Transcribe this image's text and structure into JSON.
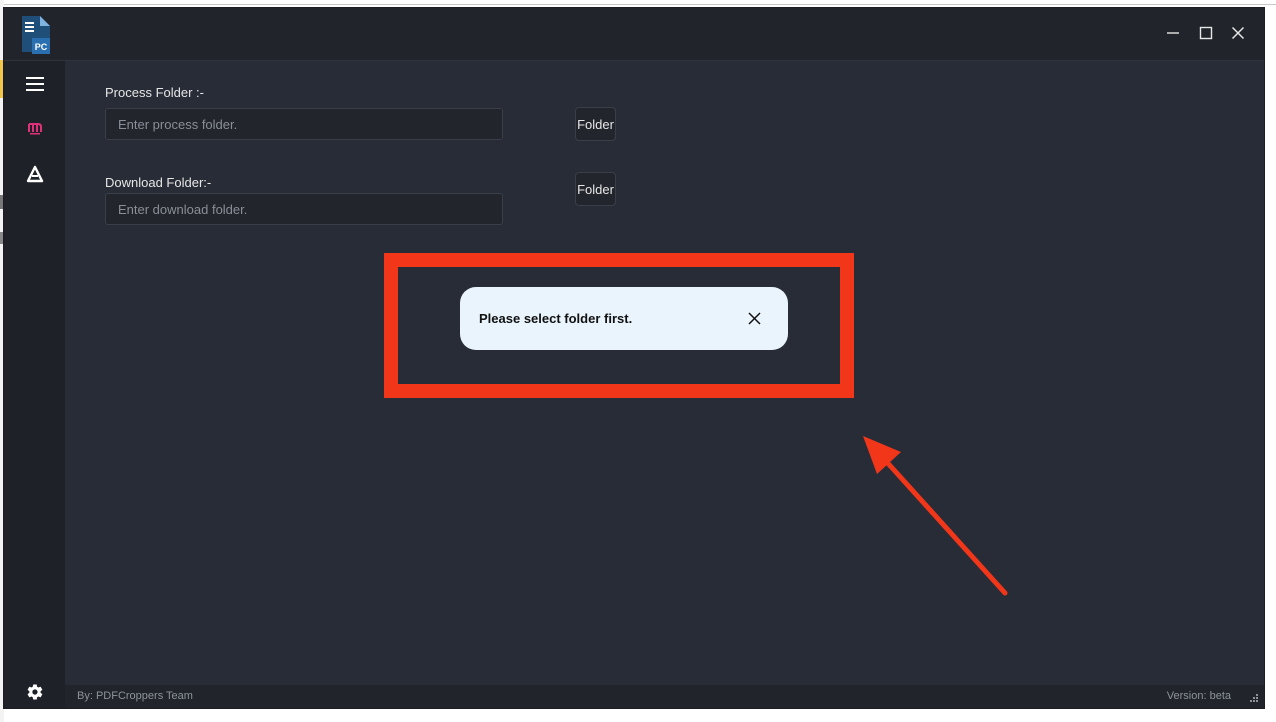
{
  "app": {
    "logo_text": "PC",
    "window_controls": {
      "minimize_icon": "minimize-icon",
      "maximize_icon": "maximize-icon",
      "close_icon": "close-icon"
    }
  },
  "sidebar": {
    "items": [
      {
        "icon": "hamburger-menu-icon"
      },
      {
        "icon": "m-logo-icon",
        "color": "#e0307a"
      },
      {
        "icon": "a-logo-icon"
      },
      {
        "icon": "gear-icon"
      }
    ]
  },
  "form": {
    "process_folder": {
      "label": "Process Folder :-",
      "placeholder": "Enter process folder.",
      "button_label": "Folder"
    },
    "download_folder": {
      "label": "Download Folder:-",
      "placeholder": "Enter download folder.",
      "button_label": "Folder"
    }
  },
  "toast": {
    "message": "Please select folder first.",
    "close_icon": "close-icon"
  },
  "annotation": {
    "color": "#f2361a"
  },
  "footer": {
    "credit": "By: PDFCroppers Team",
    "version": "Version: beta"
  },
  "colors": {
    "window_bg": "#282c36",
    "sidebar_bg": "#1e2127",
    "titlebar_bg": "#21252b",
    "toast_bg": "#eaf4fc"
  }
}
